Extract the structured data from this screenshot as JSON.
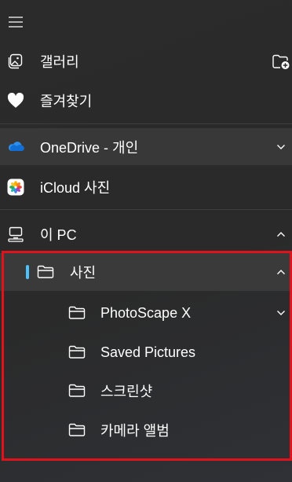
{
  "nav": {
    "menu_icon": "hamburger-icon",
    "items": [
      {
        "label": "갤러리",
        "icon": "gallery-icon"
      },
      {
        "label": "즐겨찾기",
        "icon": "heart-icon"
      },
      {
        "label": "OneDrive - 개인",
        "icon": "cloud-icon"
      },
      {
        "label": "iCloud 사진",
        "icon": "icloud-photos-icon"
      },
      {
        "label": "이 PC",
        "icon": "pc-icon"
      },
      {
        "label": "사진",
        "icon": "folder-icon"
      },
      {
        "label": "PhotoScape X",
        "icon": "folder-icon"
      },
      {
        "label": "Saved Pictures",
        "icon": "folder-icon"
      },
      {
        "label": "스크린샷",
        "icon": "folder-icon"
      },
      {
        "label": "카메라 앨범",
        "icon": "folder-icon"
      }
    ],
    "add_folder_icon": "add-folder-icon"
  },
  "colors": {
    "accent": "#4cc2ff",
    "highlight_border": "#e0121b",
    "selected_bg": "#3a3a3a"
  }
}
